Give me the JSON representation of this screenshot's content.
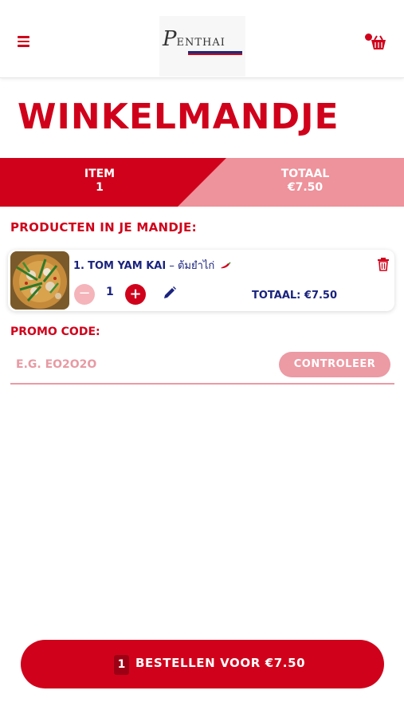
{
  "header": {
    "logo_text_first": "P",
    "logo_text_rest": "ENTHAI",
    "icons": [
      "menu-icon",
      "cart-icon"
    ]
  },
  "page": {
    "title": "WINKELMANDJE"
  },
  "summary": {
    "item_label": "ITEM",
    "item_count": "1",
    "total_label": "TOTAAL",
    "total_value": "€7.50"
  },
  "cart": {
    "section_label": "PRODUCTEN IN JE MANDJE:",
    "items": [
      {
        "number": "1.",
        "name": "TOM YAM KAI",
        "thai_name": "– ต้มยำไก่",
        "spicy_icon": "chili-icon",
        "quantity": "1",
        "total_text": "TOTAAL: €7.50"
      }
    ]
  },
  "promo": {
    "label": "PROMO CODE:",
    "placeholder": "E.G. EO2O2O",
    "button_label": "CONTROLEER"
  },
  "order": {
    "count": "1",
    "label": "BESTELLEN VOOR €7.50"
  },
  "colors": {
    "brand_red": "#d0021b",
    "light_red": "#ec9aa4",
    "navy": "#1a237e"
  }
}
